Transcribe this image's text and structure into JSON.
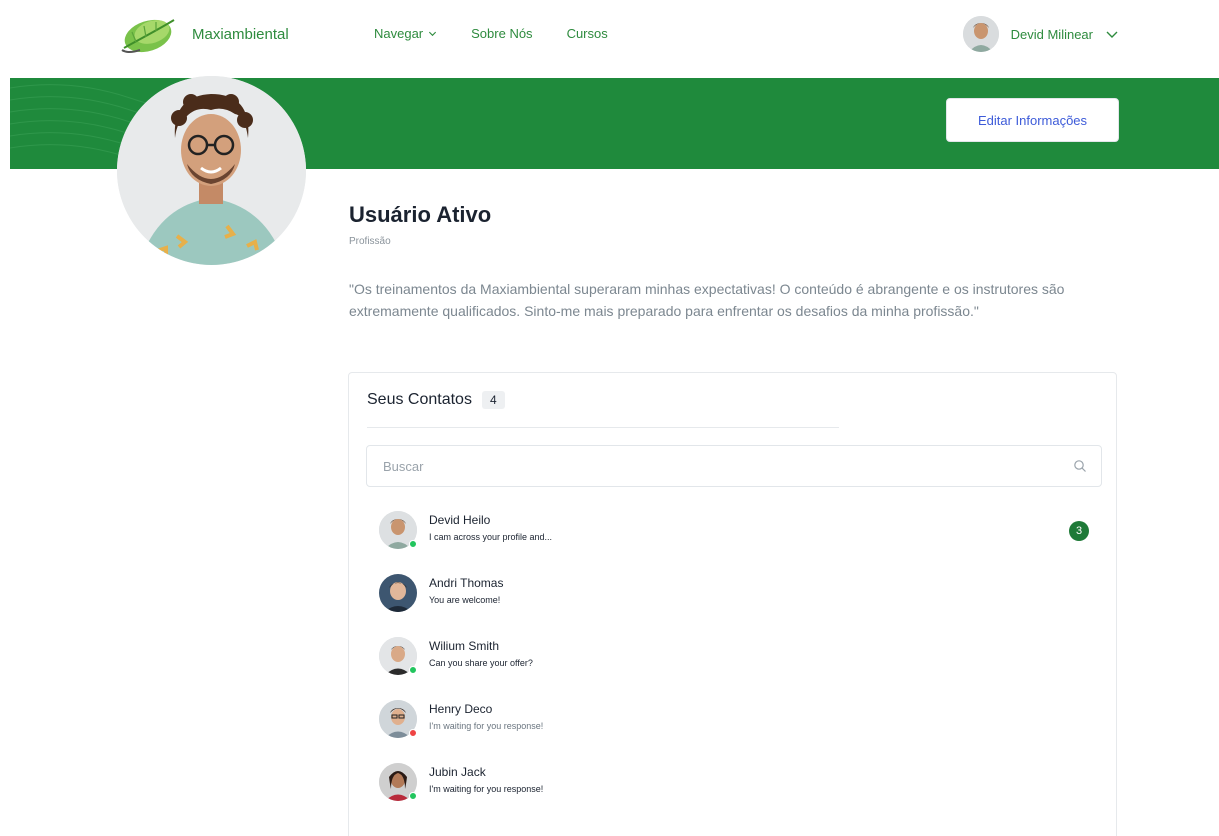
{
  "brand": {
    "name": "Maxiambiental",
    "icon": "leaf-logo-icon"
  },
  "nav": {
    "items": [
      {
        "label": "Navegar",
        "has_dropdown": true
      },
      {
        "label": "Sobre Nós",
        "has_dropdown": false
      },
      {
        "label": "Cursos",
        "has_dropdown": false
      }
    ]
  },
  "user_menu": {
    "name": "Devid Milinear",
    "icon": "chevron-down-icon"
  },
  "banner": {
    "edit_label": "Editar Informações"
  },
  "profile": {
    "name": "Usuário Ativo",
    "role": "Profissão",
    "quote": "\"Os treinamentos da Maxiambiental superaram minhas expectativas! O conteúdo é abrangente e os instrutores são extremamente qualificados. Sinto-me mais preparado para enfrentar os desafios da minha profissão.\""
  },
  "contacts": {
    "title": "Seus Contatos",
    "count": "4",
    "search_placeholder": "Buscar",
    "items": [
      {
        "name": "Devid Heilo",
        "message": "I cam across your profile and...",
        "status": "online",
        "unread": "3"
      },
      {
        "name": "Andri Thomas",
        "message": "You are welcome!",
        "status": "none",
        "unread": null
      },
      {
        "name": "Wilium Smith",
        "message": "Can you share your offer?",
        "status": "online",
        "unread": null
      },
      {
        "name": "Henry Deco",
        "message": "I'm waiting for you response!",
        "status": "busy",
        "unread": null
      },
      {
        "name": "Jubin Jack",
        "message": "I'm waiting for you response!",
        "status": "online",
        "unread": null
      }
    ]
  },
  "colors": {
    "brand_green": "#2e8b3e",
    "banner_green": "#1f8a3c",
    "badge_green": "#1f7a38",
    "status_online": "#22c55e",
    "status_busy": "#ef4444",
    "link_blue": "#3d5bd9"
  }
}
